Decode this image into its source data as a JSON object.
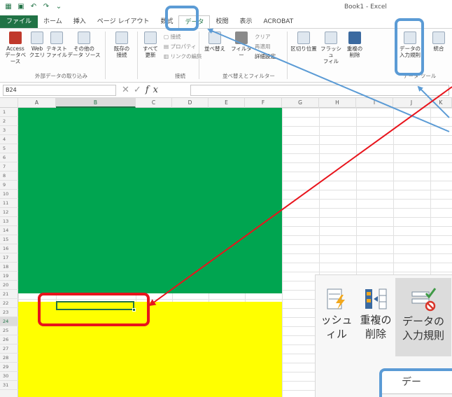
{
  "titlebar": {
    "doc_title": "Book1 - Excel",
    "quick_access": [
      "excel-logo-icon",
      "save-icon",
      "undo-icon",
      "redo-icon",
      "customize-icon"
    ]
  },
  "tabs": [
    {
      "label": "ファイル",
      "active": false
    },
    {
      "label": "ホーム",
      "active": false
    },
    {
      "label": "挿入",
      "active": false
    },
    {
      "label": "ページ レイアウト",
      "active": false
    },
    {
      "label": "数式",
      "active": false
    },
    {
      "label": "データ",
      "active": true
    },
    {
      "label": "校閲",
      "active": false
    },
    {
      "label": "表示",
      "active": false
    },
    {
      "label": "ACROBAT",
      "active": false
    }
  ],
  "ribbon": {
    "external_data": {
      "buttons": [
        {
          "label": "Access\nデータベース",
          "icon": "access-icon"
        },
        {
          "label": "Web\nクエリ",
          "icon": "web-query-icon"
        },
        {
          "label": "テキスト\nファイル",
          "icon": "text-file-icon"
        },
        {
          "label": "その他の\nデータ ソース",
          "icon": "other-sources-icon"
        }
      ],
      "group_label": "外部データの取り込み"
    },
    "existing": {
      "label": "既存の\n接続",
      "icon": "existing-connections-icon"
    },
    "connections": {
      "refresh_label": "すべて\n更新",
      "connections_cmd": "接続",
      "properties_cmd": "プロパティ",
      "edit_links_cmd": "リンクの編集",
      "group_label": "接続"
    },
    "sort_filter": {
      "sort_label": "並べ替え",
      "filter_label": "フィルター",
      "clear_cmd": "クリア",
      "reapply_cmd": "再適用",
      "advanced_cmd": "詳細設定",
      "group_label": "並べ替えとフィルター"
    },
    "data_tools": {
      "text_to_columns": "区切り位置",
      "flash_fill": "フラッシュ\nフィル",
      "remove_duplicates": "重複の\n削除",
      "data_validation": "データの\n入力規則",
      "consolidate": "統合",
      "group_label": "データ ツール"
    }
  },
  "formula_bar": {
    "name_box": "B24",
    "fx": "fx",
    "value": ""
  },
  "columns": [
    "A",
    "B",
    "C",
    "D",
    "E",
    "F",
    "G",
    "H",
    "I",
    "J",
    "K"
  ],
  "selected_column": "B",
  "rows": [
    "1",
    "2",
    "3",
    "4",
    "5",
    "6",
    "7",
    "8",
    "9",
    "10",
    "11",
    "12",
    "13",
    "14",
    "15",
    "16",
    "17",
    "18",
    "19",
    "20",
    "21",
    "22",
    "23",
    "24",
    "25",
    "26",
    "27",
    "28",
    "29",
    "30",
    "31"
  ],
  "selected_row": "24",
  "sheet": {
    "green_fill": "#00a550",
    "yellow_fill": "#ffff00",
    "active_cell": "B24"
  },
  "zoom_panel": {
    "flash_fill_label": "ッシュ\nィル",
    "remove_duplicates_label": "重複の\n削除",
    "data_validation_label": "データの\n入力規則",
    "dropdown_item": "デー"
  },
  "annotations": {
    "callout_color": "#5b9bd5",
    "highlight_color": "#e8141c"
  }
}
